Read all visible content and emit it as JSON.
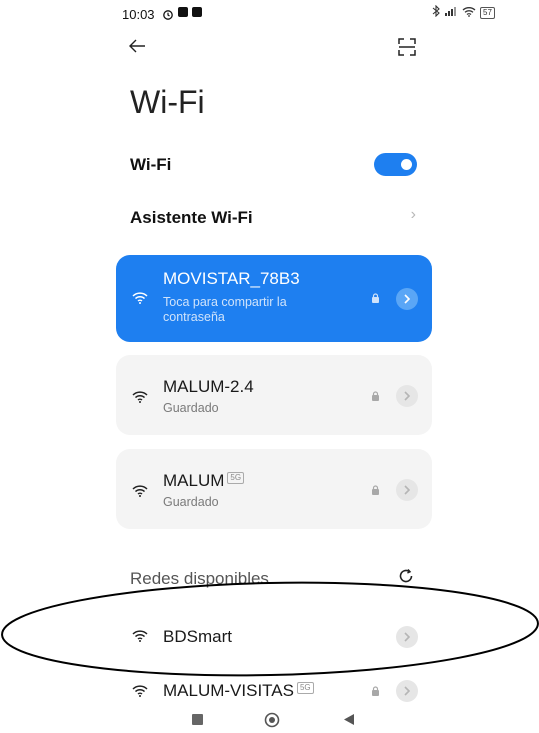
{
  "status_bar": {
    "time": "10:03",
    "battery": "57"
  },
  "header": {
    "title": "Wi-Fi",
    "back_icon": "arrow-left-icon",
    "scan_icon": "qr-scan-icon"
  },
  "wifi_toggle": {
    "label": "Wi-Fi",
    "state": "on"
  },
  "assistant": {
    "label": "Asistente Wi-Fi"
  },
  "saved_networks": [
    {
      "name": "MOVISTAR_78B3",
      "subtitle_line1": "Toca para compartir la",
      "subtitle_line2": "contraseña",
      "connected": true
    },
    {
      "name": "MALUM-2.4",
      "subtitle": "Guardado"
    },
    {
      "name": "MALUM",
      "badge": "5G",
      "subtitle": "Guardado"
    }
  ],
  "available": {
    "title": "Redes disponibles",
    "networks": [
      {
        "name": "BDSmart"
      },
      {
        "name": "MALUM-VISITAS",
        "badge": "5G"
      }
    ]
  },
  "colors": {
    "accent": "#1e7ff0",
    "card_bg": "#f4f4f4"
  }
}
